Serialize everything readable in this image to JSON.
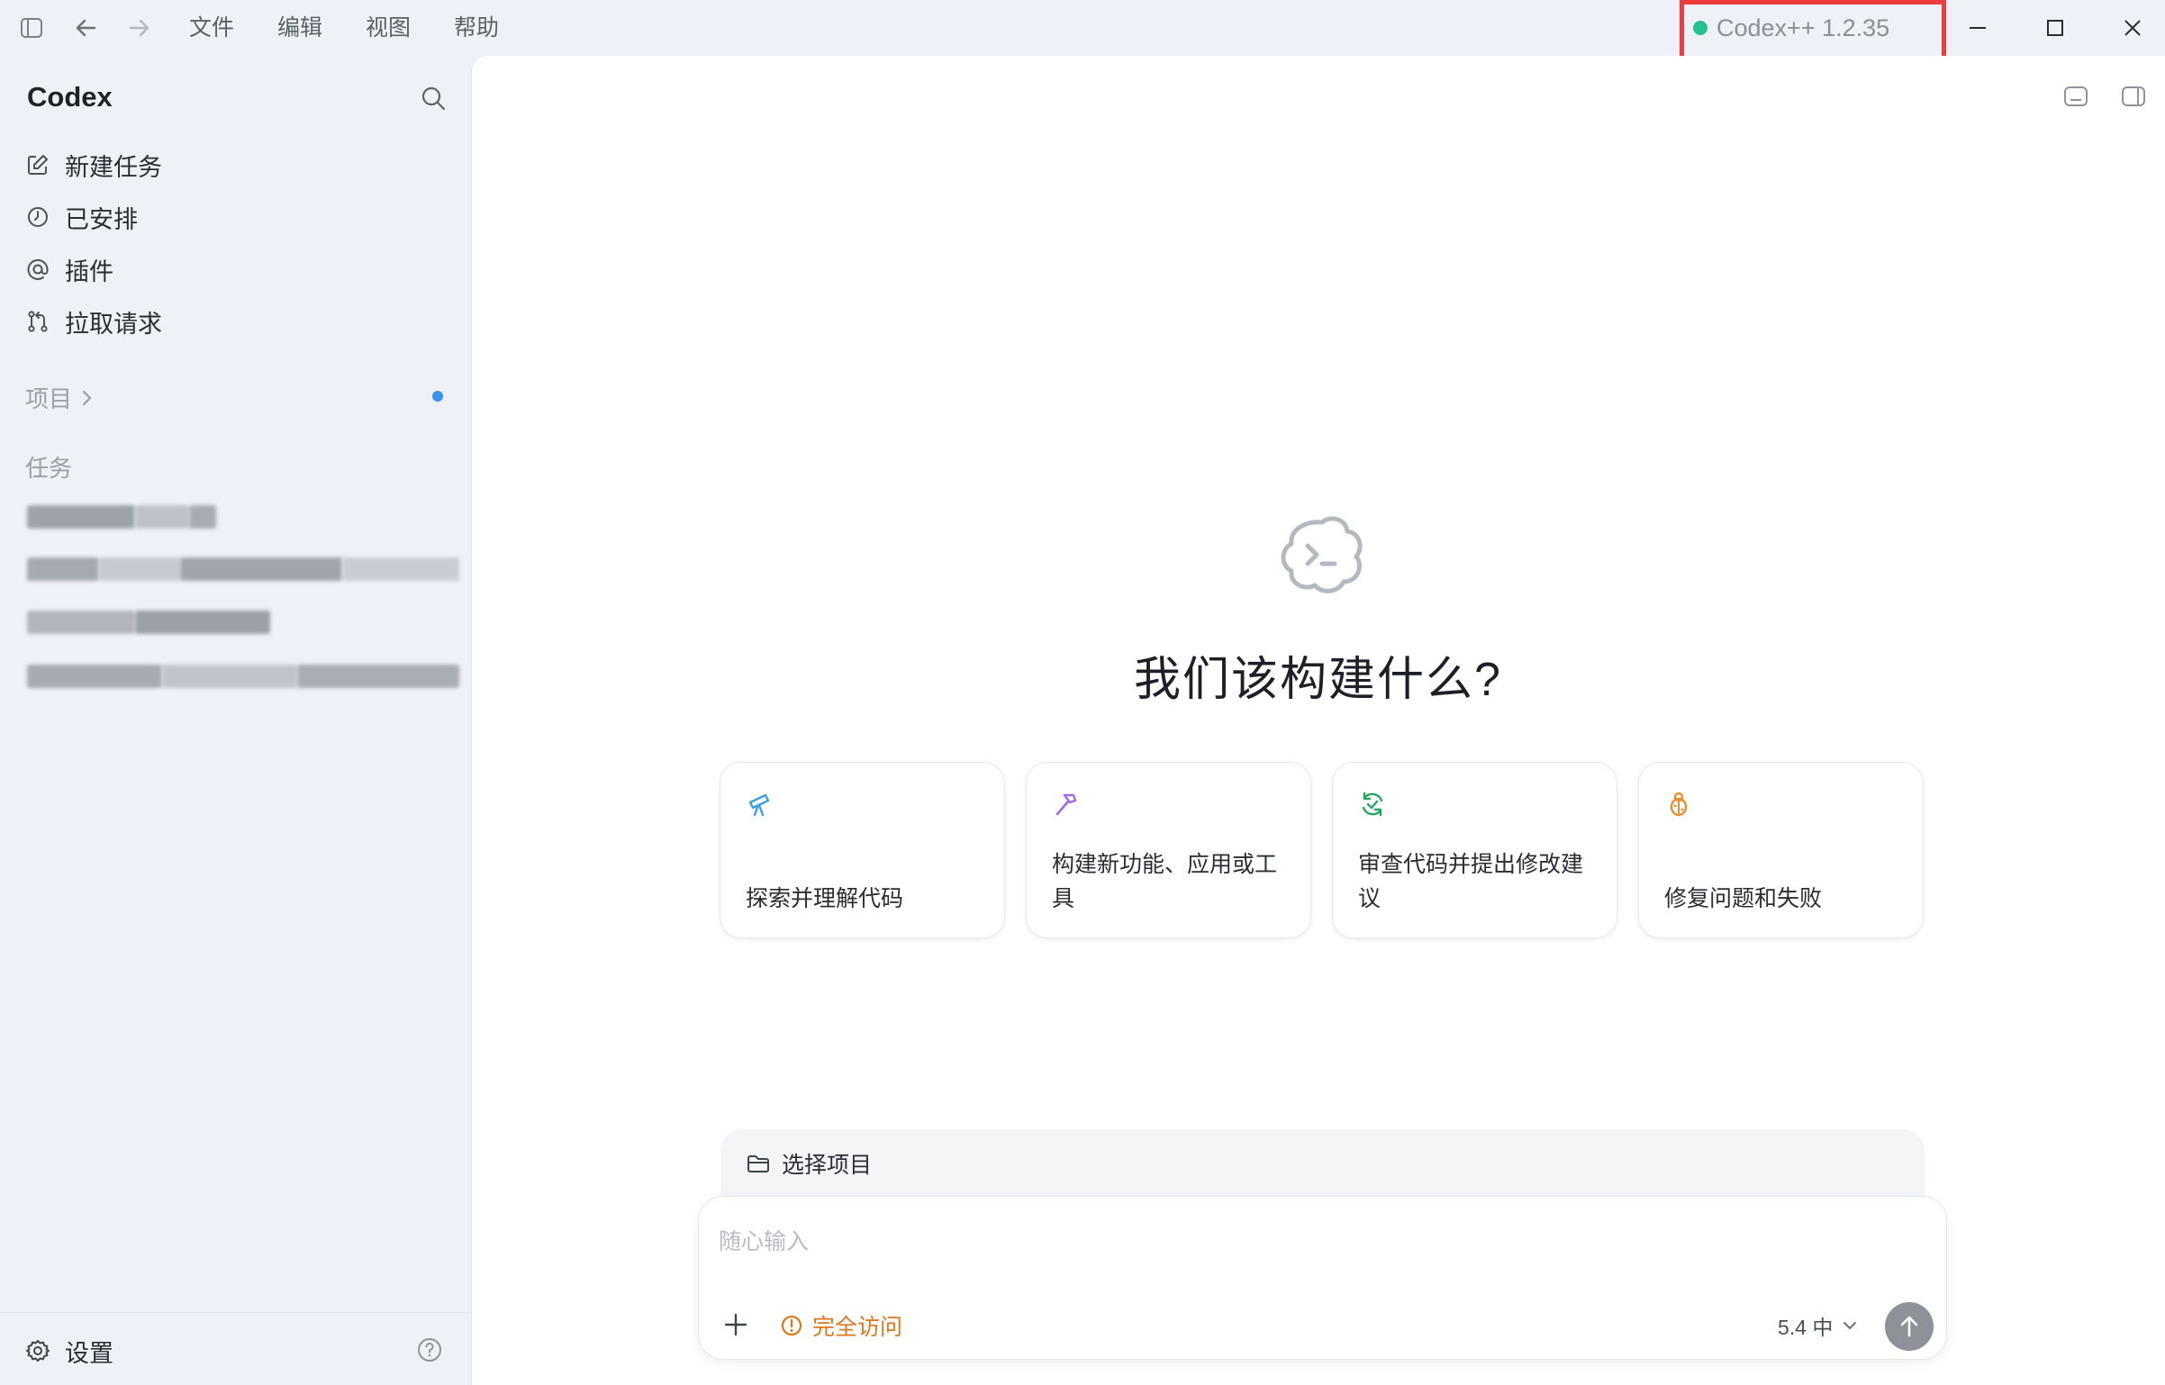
{
  "menu": {
    "file": "文件",
    "edit": "编辑",
    "view": "视图",
    "help": "帮助"
  },
  "app_version": "Codex++ 1.2.35",
  "sidebar": {
    "app_name": "Codex",
    "nav": [
      {
        "label": "新建任务",
        "icon": "edit-icon"
      },
      {
        "label": "已安排",
        "icon": "clock-icon"
      },
      {
        "label": "插件",
        "icon": "at-icon"
      },
      {
        "label": "拉取请求",
        "icon": "pull-request-icon"
      }
    ],
    "projects_label": "项目",
    "tasks_label": "任务",
    "settings_label": "设置"
  },
  "main": {
    "heading": "我们该构建什么?",
    "suggestions": [
      {
        "label": "探索并理解代码",
        "icon": "telescope-icon",
        "color": "#3b9ee8"
      },
      {
        "label": "构建新功能、应用或工具",
        "icon": "hammer-icon",
        "color": "#9b6bf0"
      },
      {
        "label": "审查代码并提出修改建议",
        "icon": "review-cycle-icon",
        "color": "#22a861"
      },
      {
        "label": "修复问题和失败",
        "icon": "bug-icon",
        "color": "#f08a2a"
      }
    ],
    "project_select_label": "选择项目",
    "composer": {
      "placeholder": "随心输入",
      "access_label": "完全访问",
      "model_label": "5.4 中"
    }
  },
  "colors": {
    "accent_red": "#ee3b3b",
    "status_green": "#22c38e",
    "access_orange": "#e0761a",
    "blue_dot": "#3b8ff0"
  }
}
